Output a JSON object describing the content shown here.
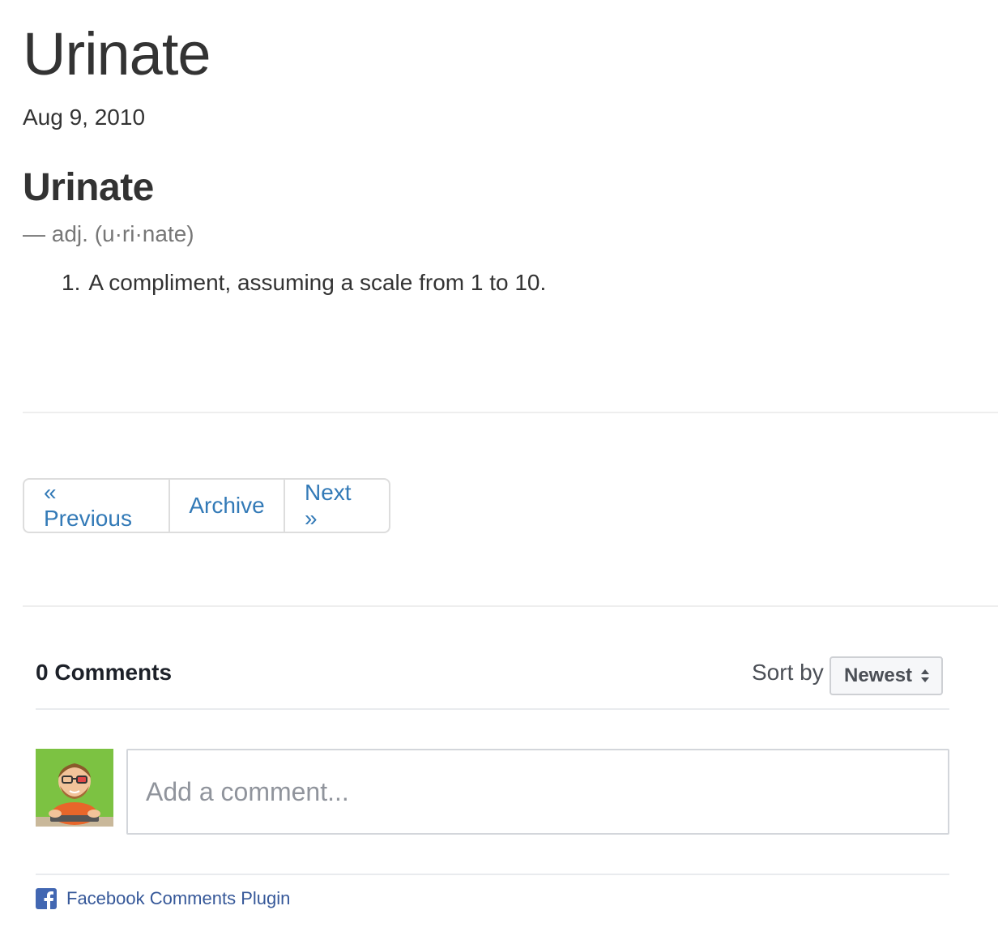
{
  "post": {
    "title": "Urinate",
    "date": "Aug 9, 2010"
  },
  "definition": {
    "word": "Urinate",
    "part_of_speech": "— adj. (u·ri·nate)",
    "senses": [
      {
        "number": "1.",
        "text": "A compliment, assuming a scale from 1 to 10."
      }
    ]
  },
  "pager": {
    "previous": "« Previous",
    "archive": "Archive",
    "next": "Next »",
    "link_color": "#337ab7"
  },
  "comments": {
    "count_label": "0 Comments",
    "sort_label": "Sort by",
    "sort_selected": "Newest",
    "input_placeholder": "Add a comment...",
    "plugin_label": "Facebook Comments Plugin",
    "plugin_color": "#365899"
  }
}
